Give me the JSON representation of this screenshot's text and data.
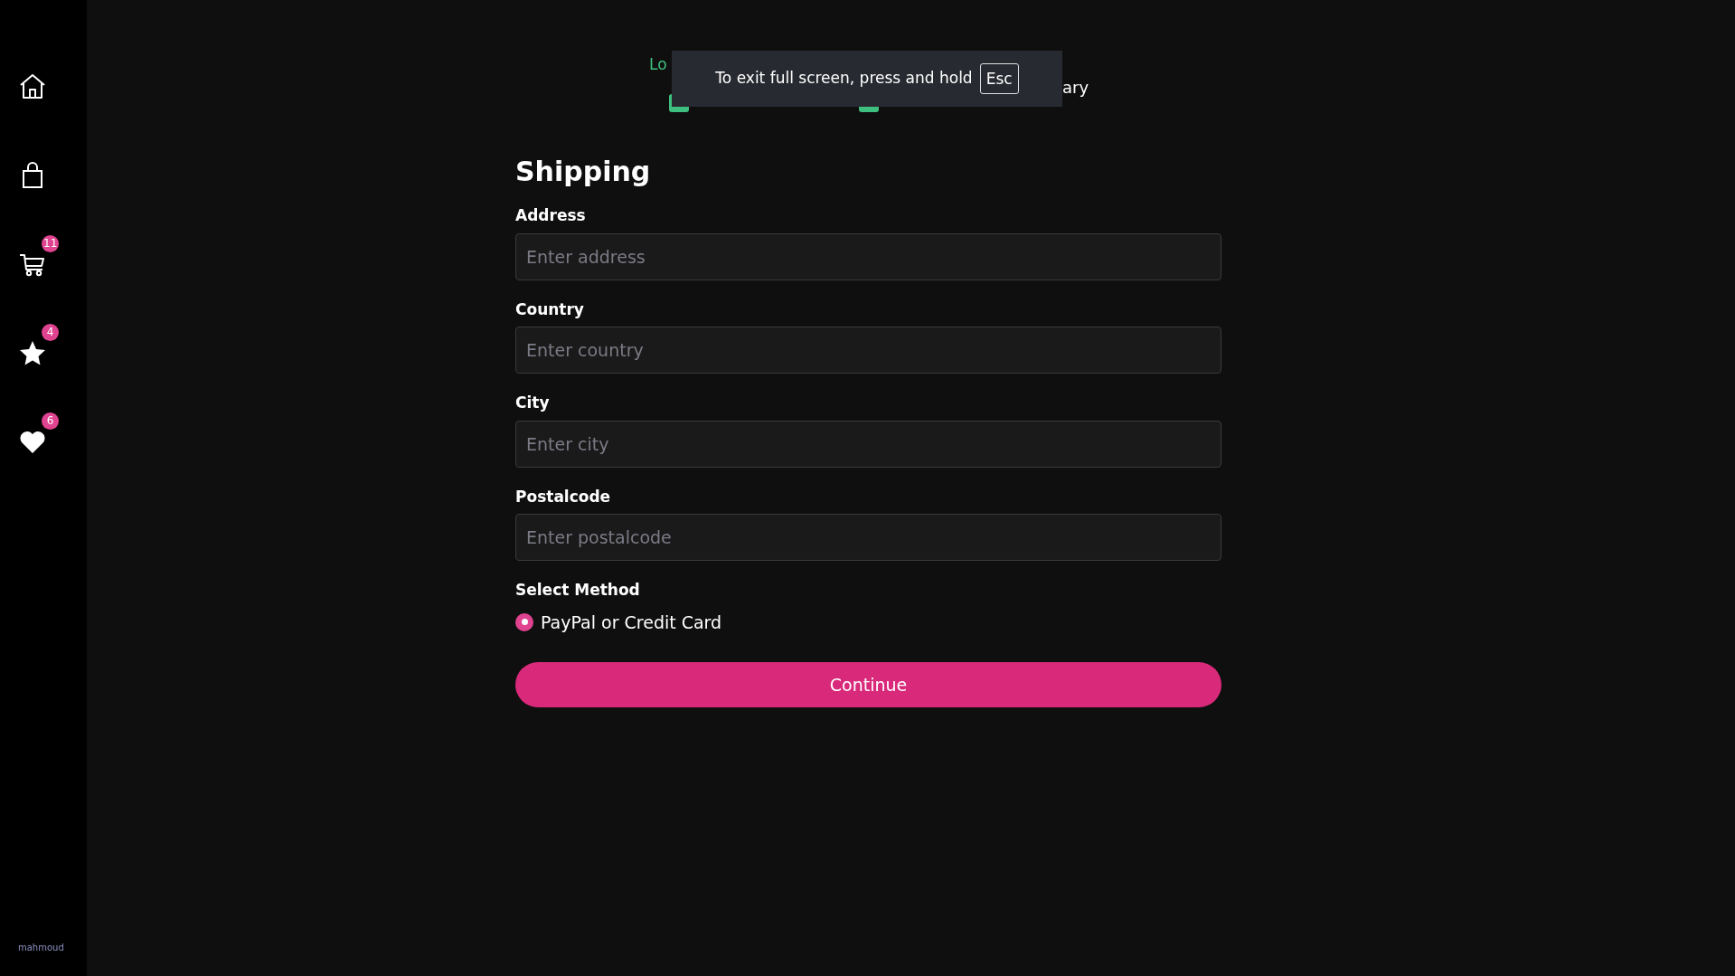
{
  "sidebar": {
    "items": [
      {
        "kind": "home"
      },
      {
        "kind": "bag"
      },
      {
        "kind": "cart",
        "badge": "11"
      },
      {
        "kind": "star",
        "badge": "4"
      },
      {
        "kind": "heart",
        "badge": "6"
      }
    ],
    "user": "mahmoud"
  },
  "steps": [
    {
      "label": "Lo",
      "completed": true
    },
    {
      "completed": true
    },
    {
      "label": "ary",
      "completed": false
    }
  ],
  "fullscreen_notice": {
    "text": "To exit full screen, press and hold",
    "key": "Esc"
  },
  "form": {
    "title": "Shipping",
    "fields": [
      {
        "label": "Address",
        "placeholder": "Enter address"
      },
      {
        "label": "Country",
        "placeholder": "Enter country"
      },
      {
        "label": "City",
        "placeholder": "Enter city"
      },
      {
        "label": "Postalcode",
        "placeholder": "Enter postalcode"
      }
    ],
    "method_label": "Select Method",
    "methods": [
      {
        "label": "PayPal or Credit Card",
        "selected": true
      }
    ],
    "button": "Continue"
  }
}
